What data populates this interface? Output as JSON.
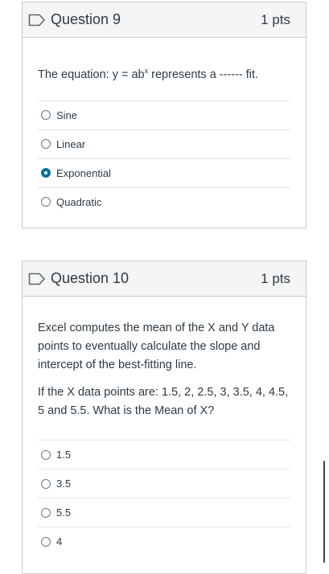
{
  "questions": [
    {
      "title": "Question 9",
      "points": "1 pts",
      "text_pre": "The equation: y = ab",
      "text_sup": "x",
      "text_post": " represents a ------ fit.",
      "answers": [
        {
          "label": "Sine",
          "selected": false
        },
        {
          "label": "Linear",
          "selected": false
        },
        {
          "label": "Exponential",
          "selected": true
        },
        {
          "label": "Quadratic",
          "selected": false
        }
      ]
    },
    {
      "title": "Question 10",
      "points": "1 pts",
      "paragraph1": "Excel computes the mean of the X and Y data points to eventually calculate the slope and intercept of the best-fitting line.",
      "paragraph2": "If the X data points are: 1.5, 2, 2.5, 3, 3.5, 4, 4.5, 5 and 5.5. What is the Mean of X?",
      "answers": [
        {
          "label": "1.5",
          "selected": false
        },
        {
          "label": "3.5",
          "selected": false
        },
        {
          "label": "5.5",
          "selected": false
        },
        {
          "label": "4",
          "selected": false
        }
      ]
    }
  ],
  "colors": {
    "accent": "#0770a3",
    "header_bg": "#f5f5f5",
    "border": "#c7cdd1"
  }
}
